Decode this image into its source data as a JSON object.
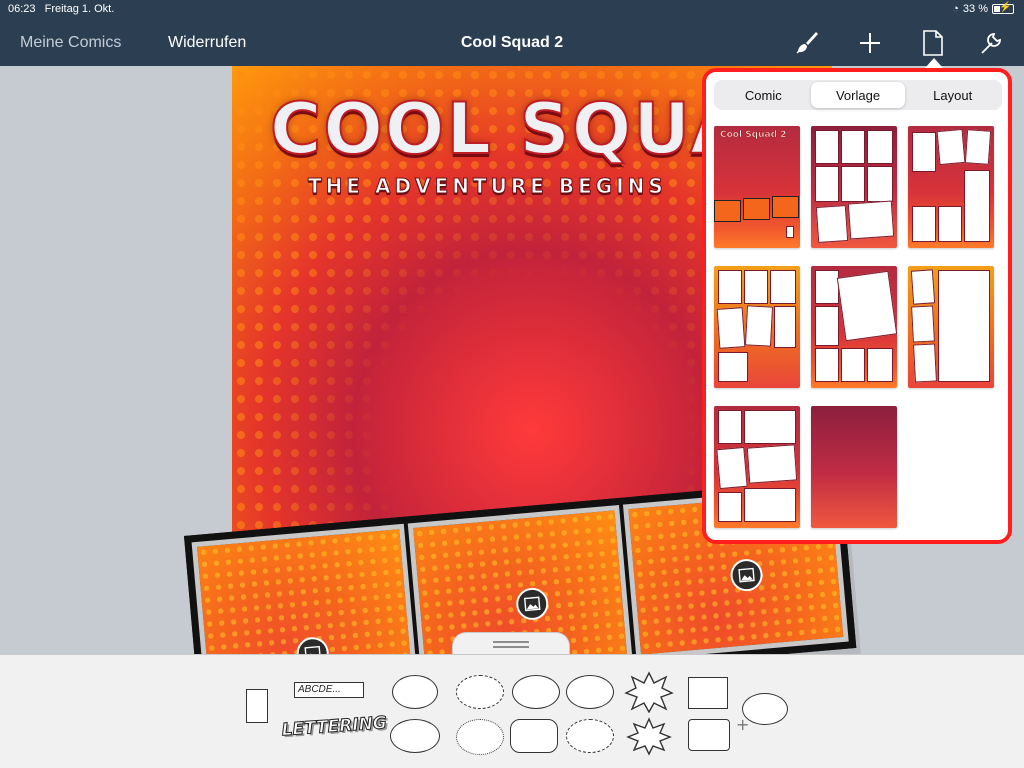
{
  "status_bar": {
    "time": "06:23",
    "date": "Freitag 1. Okt.",
    "battery": "33 %"
  },
  "nav": {
    "back_label": "Meine Comics",
    "undo_label": "Widerrufen",
    "title": "Cool Squad 2",
    "icons": [
      "brush-icon",
      "plus-icon",
      "page-icon",
      "wrench-icon"
    ]
  },
  "cover": {
    "title": "COOL SQUA",
    "subtitle": "THE ADVENTURE BEGINS"
  },
  "popover": {
    "tabs": [
      "Comic",
      "Vorlage",
      "Layout"
    ],
    "active_tab": "Vorlage",
    "templates": [
      "cover",
      "grid-a",
      "grid-b",
      "grid-c",
      "grid-d",
      "grid-e",
      "grid-f",
      "blank"
    ]
  },
  "tray": {
    "caption_text": "ABCDE...",
    "lettering_text": "LETTERING",
    "plus_glyph": "+"
  },
  "colors": {
    "nav_bg": "#2c3e52",
    "popover_border": "#ff1f1f",
    "accent": "#e5352a"
  }
}
